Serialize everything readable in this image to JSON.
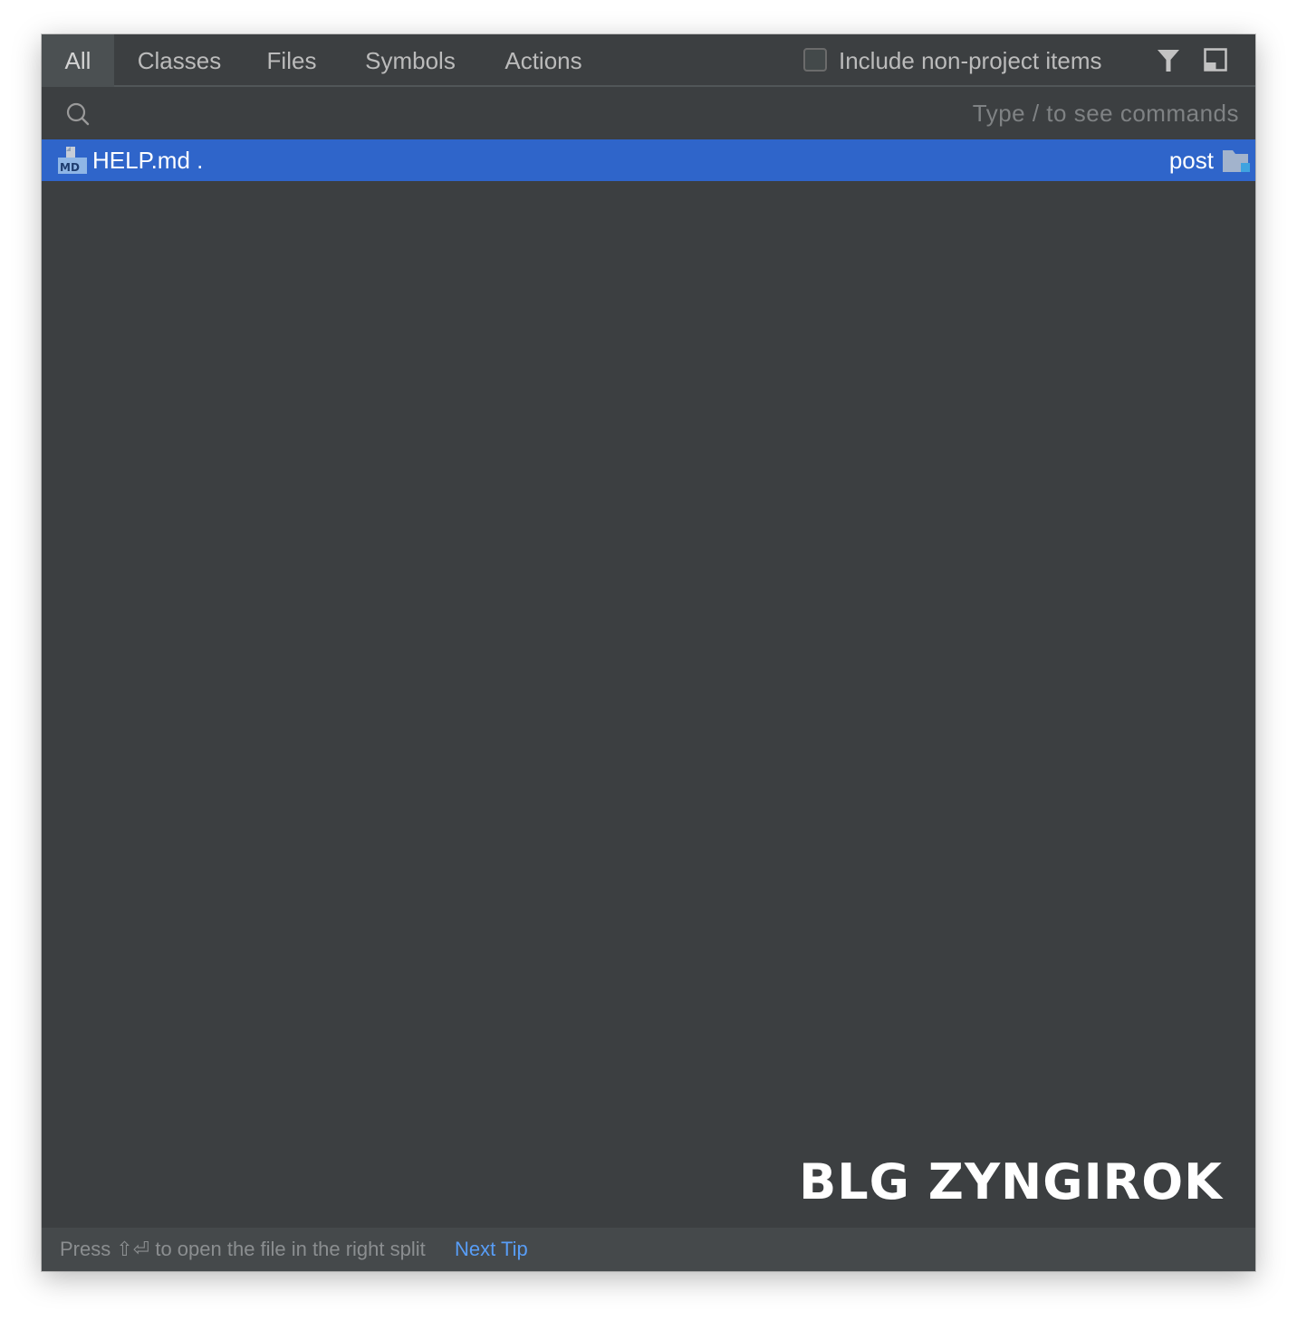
{
  "tabs": [
    {
      "label": "All",
      "active": true
    },
    {
      "label": "Classes",
      "active": false
    },
    {
      "label": "Files",
      "active": false
    },
    {
      "label": "Symbols",
      "active": false
    },
    {
      "label": "Actions",
      "active": false
    }
  ],
  "options": {
    "include_non_project_label": "Include non-project items",
    "include_non_project_checked": false,
    "filter_icon": "filter-icon",
    "preview_icon": "preview-panel-icon"
  },
  "search": {
    "value": "",
    "placeholder": "Type / to see commands",
    "icon": "search-icon"
  },
  "results": [
    {
      "icon": "markdown-file-icon",
      "name": "HELP.md .",
      "location": "post",
      "location_icon": "folder-icon",
      "selected": true
    }
  ],
  "watermark": "BLG ZYNGIROK",
  "footer": {
    "tip_text": "Press ⇧⏎ to open the file in the right split",
    "next_tip_label": "Next Tip"
  },
  "colors": {
    "panel_bg": "#3c3f41",
    "active_tab_bg": "#4b5052",
    "selection_bg": "#2f65ca",
    "link": "#589df6",
    "footer_bg": "#45494b"
  }
}
